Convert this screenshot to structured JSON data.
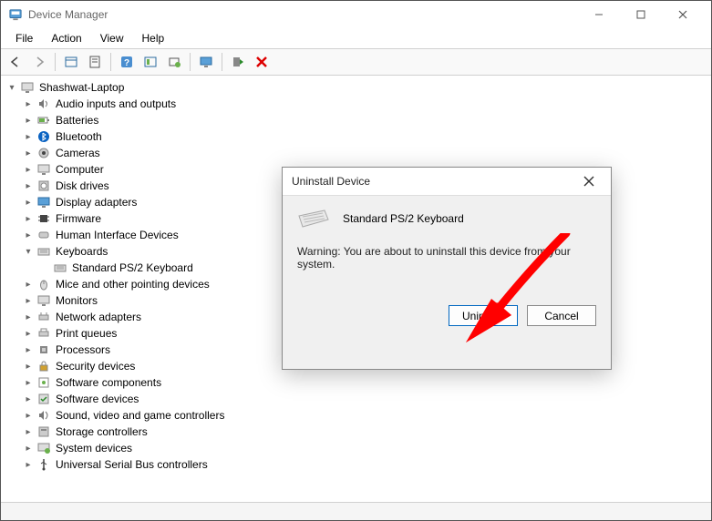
{
  "window": {
    "title": "Device Manager",
    "menubar": [
      "File",
      "Action",
      "View",
      "Help"
    ]
  },
  "tree": {
    "root": "Shashwat-Laptop",
    "items": [
      "Audio inputs and outputs",
      "Batteries",
      "Bluetooth",
      "Cameras",
      "Computer",
      "Disk drives",
      "Display adapters",
      "Firmware",
      "Human Interface Devices",
      "Keyboards",
      "Mice and other pointing devices",
      "Monitors",
      "Network adapters",
      "Print queues",
      "Processors",
      "Security devices",
      "Software components",
      "Software devices",
      "Sound, video and game controllers",
      "Storage controllers",
      "System devices",
      "Universal Serial Bus controllers"
    ],
    "keyboard_child": "Standard PS/2 Keyboard"
  },
  "dialog": {
    "title": "Uninstall Device",
    "device_name": "Standard PS/2 Keyboard",
    "warning": "Warning: You are about to uninstall this device from your system.",
    "primary_btn": "Uninstall",
    "cancel_btn": "Cancel"
  }
}
